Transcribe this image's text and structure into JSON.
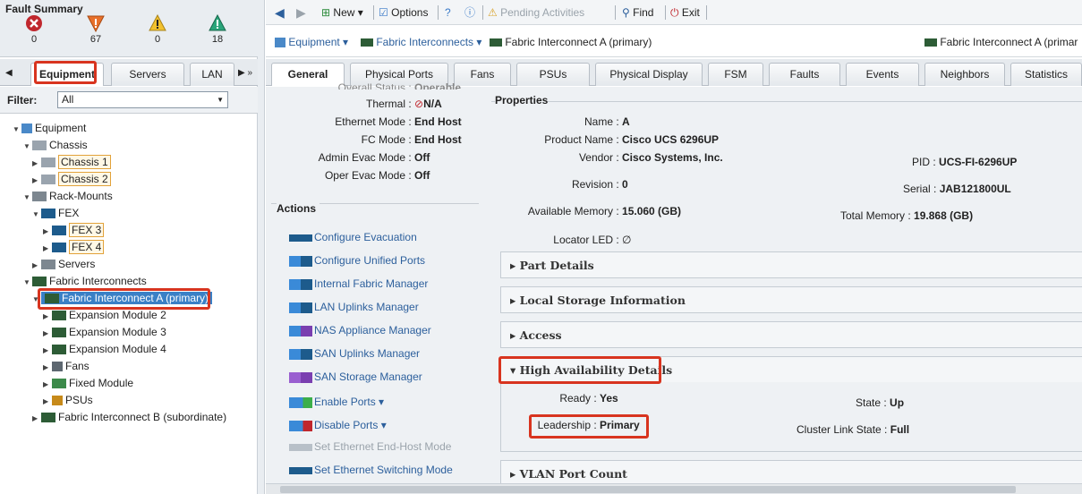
{
  "fault_summary": {
    "title": "Fault Summary",
    "critical": "0",
    "major": "67",
    "minor": "0",
    "warning": "18"
  },
  "left_tabs": {
    "equipment": "Equipment",
    "servers": "Servers",
    "lan": "LAN"
  },
  "filter": {
    "label": "Filter:",
    "value": "All"
  },
  "tree": {
    "equipment": "Equipment",
    "chassis": "Chassis",
    "chassis1": "Chassis 1",
    "chassis2": "Chassis 2",
    "rack_mounts": "Rack-Mounts",
    "fex": "FEX",
    "fex3": "FEX 3",
    "fex4": "FEX 4",
    "servers": "Servers",
    "fabric_interconnects": "Fabric Interconnects",
    "fi_a": "Fabric Interconnect A (primary)",
    "exp2": "Expansion Module 2",
    "exp3": "Expansion Module 3",
    "exp4": "Expansion Module 4",
    "fans": "Fans",
    "fixed": "Fixed Module",
    "psus": "PSUs",
    "fi_b": "Fabric Interconnect B (subordinate)"
  },
  "toolbar": {
    "new": "New",
    "options": "Options",
    "pending": "Pending Activities",
    "find": "Find",
    "exit": "Exit"
  },
  "breadcrumb": {
    "equipment": "Equipment",
    "fabric_interconnects": "Fabric Interconnects",
    "current": "Fabric Interconnect A (primary)",
    "right_title": "Fabric Interconnect A (primar"
  },
  "tabs": [
    "General",
    "Physical Ports",
    "Fans",
    "PSUs",
    "Physical Display",
    "FSM",
    "Faults",
    "Events",
    "Neighbors",
    "Statistics"
  ],
  "status": {
    "overall_label": "Overall Status",
    "overall_value": "Operable",
    "thermal_label": "Thermal",
    "thermal_value": "N/A",
    "eth_mode_label": "Ethernet Mode",
    "eth_mode_value": "End Host",
    "fc_mode_label": "FC Mode",
    "fc_mode_value": "End Host",
    "admin_evac_label": "Admin Evac Mode",
    "admin_evac_value": "Off",
    "oper_evac_label": "Oper Evac Mode",
    "oper_evac_value": "Off"
  },
  "actions": {
    "title": "Actions",
    "items": [
      "Configure Evacuation",
      "Configure Unified Ports",
      "Internal Fabric Manager",
      "LAN Uplinks Manager",
      "NAS Appliance Manager",
      "SAN Uplinks Manager",
      "SAN Storage Manager",
      "Enable Ports",
      "Disable Ports",
      "Set Ethernet End-Host Mode",
      "Set Ethernet Switching Mode"
    ]
  },
  "properties": {
    "title": "Properties",
    "name_label": "Name",
    "name_value": "A",
    "product_label": "Product Name",
    "product_value": "Cisco UCS 6296UP",
    "vendor_label": "Vendor",
    "vendor_value": "Cisco Systems, Inc.",
    "pid_label": "PID",
    "pid_value": "UCS-FI-6296UP",
    "revision_label": "Revision",
    "revision_value": "0",
    "serial_label": "Serial",
    "serial_value": "JAB121800UL",
    "avail_mem_label": "Available Memory",
    "avail_mem_value": "15.060 (GB)",
    "total_mem_label": "Total Memory",
    "total_mem_value": "19.868 (GB)",
    "locator_label": "Locator LED",
    "locator_value": "∅"
  },
  "sections": {
    "part": "Part Details",
    "storage": "Local Storage Information",
    "access": "Access",
    "ha": "High Availability Details",
    "vlan": "VLAN Port Count"
  },
  "ha": {
    "ready_label": "Ready",
    "ready_value": "Yes",
    "state_label": "State",
    "state_value": "Up",
    "leadership_label": "Leadership",
    "leadership_value": "Primary",
    "cluster_label": "Cluster Link State",
    "cluster_value": "Full"
  }
}
